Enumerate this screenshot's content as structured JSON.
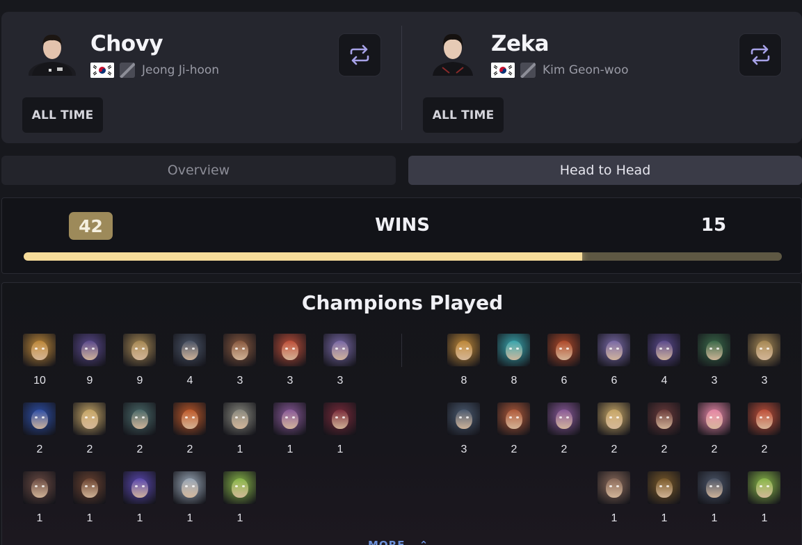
{
  "player1": {
    "name": "Chovy",
    "real_name": "Jeong Ji-hoon",
    "country_flag": "korea-flag-icon",
    "period": "ALL TIME"
  },
  "player2": {
    "name": "Zeka",
    "real_name": "Kim Geon-woo",
    "country_flag": "korea-flag-icon",
    "period": "ALL TIME"
  },
  "tabs": {
    "overview": "Overview",
    "head_to_head": "Head to Head",
    "active": "head_to_head"
  },
  "wins": {
    "label": "WINS",
    "player1": "42",
    "player2": "15",
    "player1_share": 0.737,
    "bar_fill_color": "#f6dc9a",
    "bar_rest_color": "#5e5843"
  },
  "champions": {
    "title": "Champions Played",
    "more_label": "MORE",
    "player1": [
      {
        "count": "10",
        "color": "#c08a3a"
      },
      {
        "count": "9",
        "color": "#5b4a8e"
      },
      {
        "count": "9",
        "color": "#a88a55"
      },
      {
        "count": "4",
        "color": "#4b5568"
      },
      {
        "count": "3",
        "color": "#8a5a40"
      },
      {
        "count": "3",
        "color": "#c0503a"
      },
      {
        "count": "3",
        "color": "#7a6aa8"
      },
      {
        "count": "2",
        "color": "#2d4fa8"
      },
      {
        "count": "2",
        "color": "#c8a868"
      },
      {
        "count": "2",
        "color": "#4a6a6a"
      },
      {
        "count": "2",
        "color": "#c05a2a"
      },
      {
        "count": "1",
        "color": "#8a8a80"
      },
      {
        "count": "1",
        "color": "#8a5a9a"
      },
      {
        "count": "1",
        "color": "#7a2a3a"
      },
      {
        "count": "1",
        "color": "#6a4a42"
      },
      {
        "count": "1",
        "color": "#6a4230"
      },
      {
        "count": "1",
        "color": "#5a48b0"
      },
      {
        "count": "1",
        "color": "#9aa8b8"
      },
      {
        "count": "1",
        "color": "#8ab84a"
      }
    ],
    "player2": [
      {
        "count": "8",
        "color": "#c08a3a"
      },
      {
        "count": "8",
        "color": "#3aa8b0"
      },
      {
        "count": "6",
        "color": "#b04a2a"
      },
      {
        "count": "6",
        "color": "#7a6aa8"
      },
      {
        "count": "4",
        "color": "#5b4a8e"
      },
      {
        "count": "3",
        "color": "#3a6a4a"
      },
      {
        "count": "3",
        "color": "#a88a55"
      },
      {
        "count": "3",
        "color": "#4a5a70"
      },
      {
        "count": "2",
        "color": "#b05a3a"
      },
      {
        "count": "2",
        "color": "#8a5a9a"
      },
      {
        "count": "2",
        "color": "#c8a868"
      },
      {
        "count": "2",
        "color": "#6a3a3a"
      },
      {
        "count": "2",
        "color": "#e888a8"
      },
      {
        "count": "2",
        "color": "#c0503a"
      },
      {
        "count": "1",
        "color": "#8a6a5a"
      },
      {
        "count": "1",
        "color": "#7a5a2a"
      },
      {
        "count": "1",
        "color": "#4b5568"
      },
      {
        "count": "1",
        "color": "#8ab84a"
      }
    ]
  }
}
